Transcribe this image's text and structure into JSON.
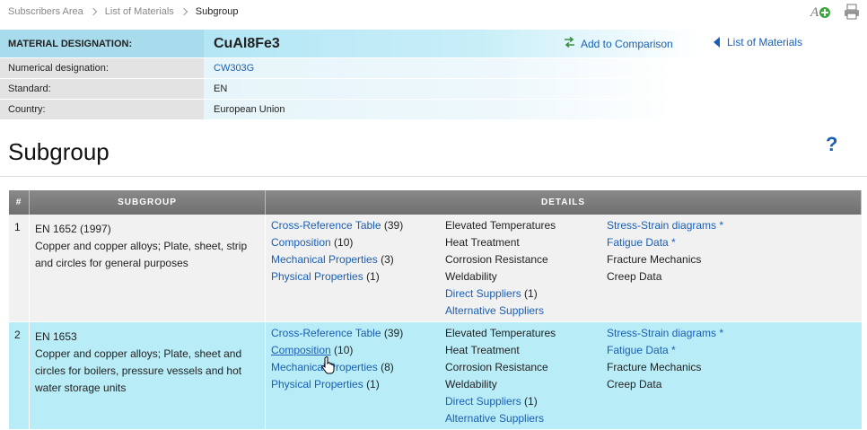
{
  "breadcrumb": [
    "Subscribers Area",
    "List of Materials",
    "Subgroup"
  ],
  "material": {
    "designation_label": "MATERIAL DESIGNATION:",
    "designation_value": "CuAl8Fe3",
    "rows": [
      {
        "label": "Numerical designation:",
        "value": "CW303G",
        "link": true
      },
      {
        "label": "Standard:",
        "value": "EN",
        "link": false
      },
      {
        "label": "Country:",
        "value": "European Union",
        "link": false
      }
    ]
  },
  "actions": {
    "compare": "Add to Comparison",
    "list_of_materials": "List of Materials"
  },
  "page_title": "Subgroup",
  "help": "?",
  "table": {
    "headers": [
      "#",
      "SUBGROUP",
      "DETAILS"
    ],
    "rows": [
      {
        "num": "1",
        "standard": "EN 1652 (1997)",
        "description": "Copper and copper alloys; Plate, sheet, strip and circles for general purposes",
        "col_a": [
          {
            "text": "Cross-Reference Table",
            "count": "(39)"
          },
          {
            "text": "Composition",
            "count": "(10)"
          },
          {
            "text": "Mechanical Properties",
            "count": "(3)"
          },
          {
            "text": "Physical Properties",
            "count": "(1)"
          }
        ],
        "col_b": [
          {
            "text": "Elevated Temperatures",
            "link": false
          },
          {
            "text": "Heat Treatment",
            "link": false
          },
          {
            "text": "Corrosion Resistance",
            "link": false
          },
          {
            "text": "Weldability",
            "link": false
          },
          {
            "text": "Direct Suppliers",
            "count": "(1)",
            "link": true
          },
          {
            "text": "Alternative Suppliers",
            "link": true
          }
        ],
        "col_c": [
          {
            "text": "Stress-Strain diagrams *",
            "link": true
          },
          {
            "text": "Fatigue Data *",
            "link": true
          },
          {
            "text": "Fracture Mechanics",
            "link": false
          },
          {
            "text": "Creep Data",
            "link": false
          }
        ]
      },
      {
        "num": "2",
        "standard": "EN 1653",
        "description": "Copper and copper alloys; Plate, sheet and circles for boilers, pressure vessels and hot water storage units",
        "col_a": [
          {
            "text": "Cross-Reference Table",
            "count": "(39)"
          },
          {
            "text": "Composition",
            "count": "(10)"
          },
          {
            "text": "Mechanical Properties",
            "count": "(8)"
          },
          {
            "text": "Physical Properties",
            "count": "(1)"
          }
        ],
        "col_b": [
          {
            "text": "Elevated Temperatures",
            "link": false
          },
          {
            "text": "Heat Treatment",
            "link": false
          },
          {
            "text": "Corrosion Resistance",
            "link": false
          },
          {
            "text": "Weldability",
            "link": false
          },
          {
            "text": "Direct Suppliers",
            "count": "(1)",
            "link": true
          },
          {
            "text": "Alternative Suppliers",
            "link": true
          }
        ],
        "col_c": [
          {
            "text": "Stress-Strain diagrams *",
            "link": true
          },
          {
            "text": "Fatigue Data *",
            "link": true
          },
          {
            "text": "Fracture Mechanics",
            "link": false
          },
          {
            "text": "Creep Data",
            "link": false
          }
        ]
      }
    ]
  },
  "icons": [
    "add-font-size-icon",
    "print-icon",
    "compare-arrows-icon",
    "back-triangle-icon",
    "help-icon",
    "hand-cursor-icon"
  ],
  "colors": {
    "link": "#1a5fb4",
    "row_highlight": "#b8ecf7",
    "header_gray": "#7d7d7d",
    "designation_bg": "#a8dcec"
  }
}
